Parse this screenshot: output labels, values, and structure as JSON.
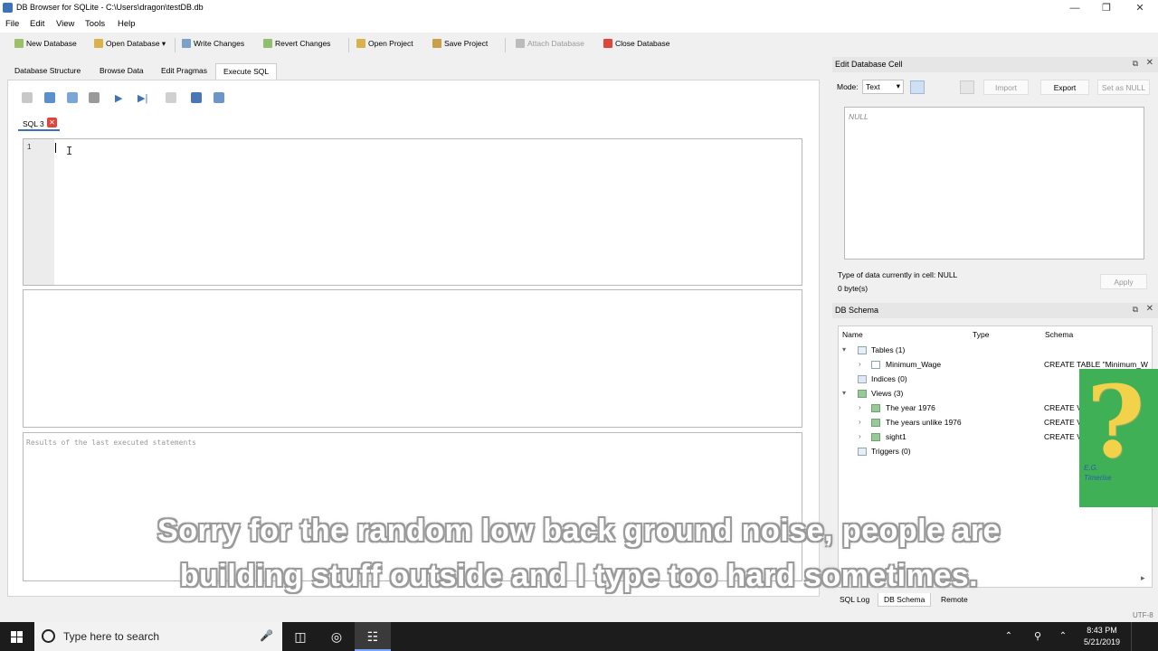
{
  "window": {
    "title": "DB Browser for SQLite - C:\\Users\\dragon\\testDB.db",
    "minimize": "—",
    "restore": "❐",
    "close": "✕"
  },
  "menu": [
    "File",
    "Edit",
    "View",
    "Tools",
    "Help"
  ],
  "toolbar": {
    "new_database": "New Database",
    "open_database": "Open Database",
    "write_changes": "Write Changes",
    "revert_changes": "Revert Changes",
    "open_project": "Open Project",
    "save_project": "Save Project",
    "attach_database": "Attach Database",
    "close_database": "Close Database"
  },
  "tabs": [
    "Database Structure",
    "Browse Data",
    "Edit Pragmas",
    "Execute SQL"
  ],
  "sql_tab": {
    "label": "SQL 3",
    "close": "✕"
  },
  "editor": {
    "line_number": "1",
    "ibeam": "I"
  },
  "messages": {
    "placeholder": "Results of the last executed statements"
  },
  "edit_cell": {
    "title": "Edit Database Cell",
    "mode_label": "Mode:",
    "mode_value": "Text",
    "import": "Import",
    "export": "Export",
    "set_null": "Set as NULL",
    "content": "NULL",
    "type_info": "Type of data currently in cell: NULL",
    "size_info": "0 byte(s)",
    "apply": "Apply"
  },
  "schema": {
    "title": "DB Schema",
    "headers": {
      "name": "Name",
      "type": "Type",
      "schema": "Schema"
    },
    "tables_label": "Tables (1)",
    "table_row": {
      "name": "Minimum_Wage",
      "schema": "CREATE TABLE \"Minimum_W"
    },
    "indices_label": "Indices (0)",
    "views_label": "Views (3)",
    "views": [
      {
        "name": "The year 1976",
        "schema": "CREATE V"
      },
      {
        "name": "The years unlike 1976",
        "schema": "CREATE V"
      },
      {
        "name": "sight1",
        "schema": "CREATE V"
      }
    ],
    "triggers_label": "Triggers (0)"
  },
  "bottom_tabs": [
    "SQL Log",
    "DB Schema",
    "Remote"
  ],
  "status": {
    "encoding": "UTF-8"
  },
  "taskbar": {
    "search_placeholder": "Type here to search",
    "time": "8:43 PM",
    "date": "5/21/2019"
  },
  "caption": {
    "line1": "Sorry for the random low back ground noise, people are",
    "line2": "building stuff outside and I type too hard sometimes."
  },
  "sticker": {
    "glyph": "?",
    "signature_line1": "E.G.",
    "signature_line2": "Timerise"
  },
  "colors": {
    "accent": "#3d72b8",
    "close_red": "#e0453b",
    "taskbar": "#1c1c1c",
    "sticker_green": "#3fb056"
  }
}
